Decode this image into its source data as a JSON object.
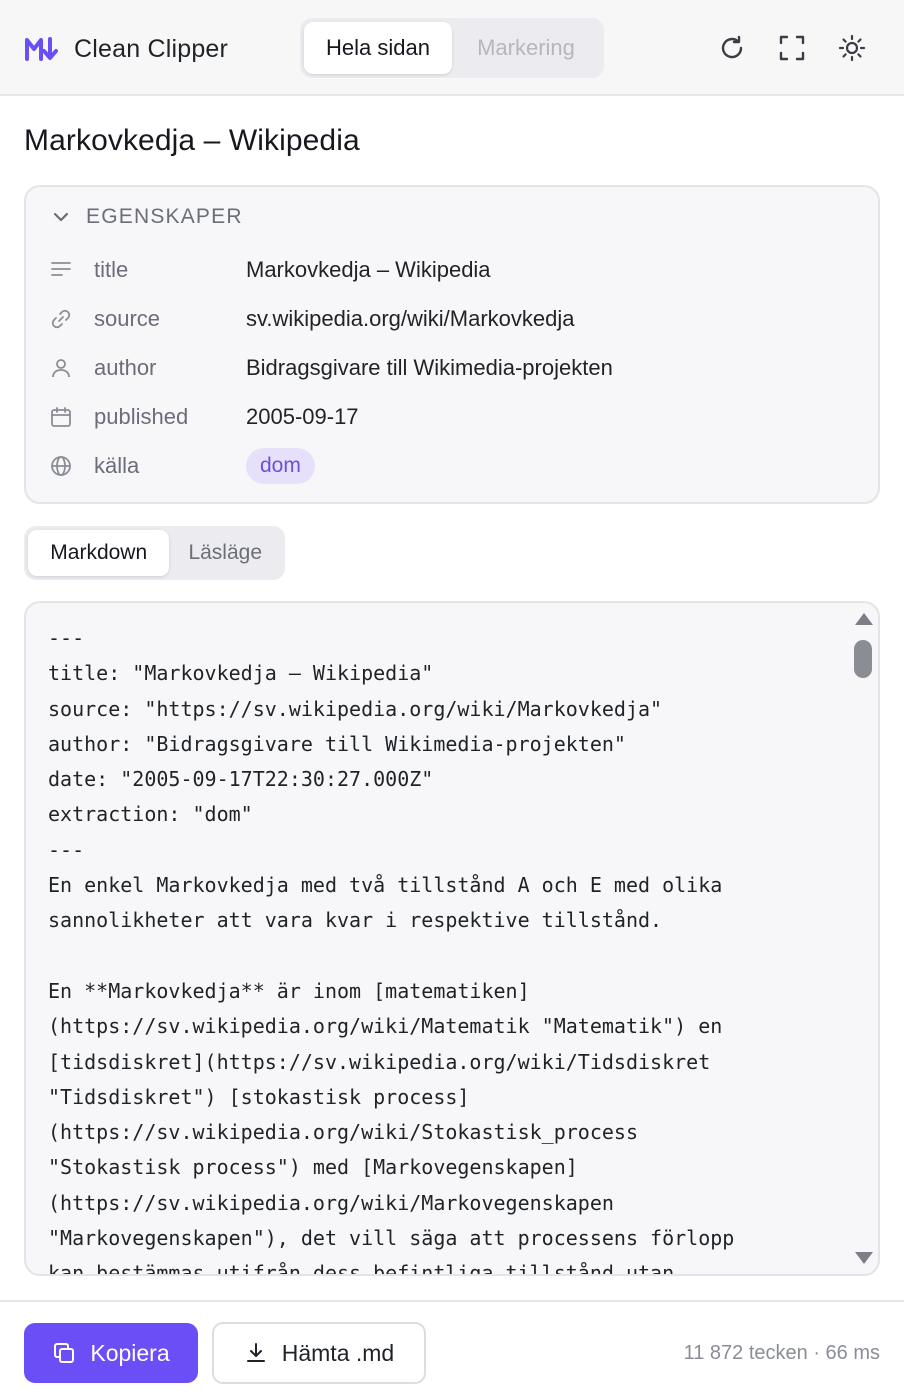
{
  "header": {
    "app_name": "Clean Clipper",
    "modes": [
      "Hela sidan",
      "Markering"
    ],
    "active_mode": "Hela sidan",
    "icons": [
      "refresh-icon",
      "expand-icon",
      "theme-sun-icon"
    ]
  },
  "page": {
    "title": "Markovkedja – Wikipedia"
  },
  "properties": {
    "heading": "EGENSKAPER",
    "rows": [
      {
        "icon": "text-lines-icon",
        "key": "title",
        "value": "Markovkedja – Wikipedia"
      },
      {
        "icon": "link-icon",
        "key": "source",
        "value": "sv.wikipedia.org/wiki/Markovkedja"
      },
      {
        "icon": "user-icon",
        "key": "author",
        "value": "Bidragsgivare till Wikimedia-projekten"
      },
      {
        "icon": "calendar-icon",
        "key": "published",
        "value": "2005-09-17"
      },
      {
        "icon": "globe-icon",
        "key": "källa",
        "value": "dom"
      }
    ]
  },
  "view_tabs": {
    "tabs": [
      "Markdown",
      "Läsläge"
    ],
    "active": "Markdown"
  },
  "markdown": {
    "text": "---\ntitle: \"Markovkedja – Wikipedia\"\nsource: \"https://sv.wikipedia.org/wiki/Markovkedja\"\nauthor: \"Bidragsgivare till Wikimedia-projekten\"\ndate: \"2005-09-17T22:30:27.000Z\"\nextraction: \"dom\"\n---\nEn enkel Markovkedja med två tillstånd A och E med olika\nsannolikheter att vara kvar i respektive tillstånd.\n\nEn **Markovkedja** är inom [matematiken]\n(https://sv.wikipedia.org/wiki/Matematik \"Matematik\") en\n[tidsdiskret](https://sv.wikipedia.org/wiki/Tidsdiskret\n\"Tidsdiskret\") [stokastisk process]\n(https://sv.wikipedia.org/wiki/Stokastisk_process\n\"Stokastisk process\") med [Markovegenskapen]\n(https://sv.wikipedia.org/wiki/Markovegenskapen\n\"Markovegenskapen\"), det vill säga att processens förlopp\nkan bestämmas utifrån dess befintliga tillstånd utan"
  },
  "footer": {
    "copy_label": "Kopiera",
    "download_label": "Hämta .md",
    "stats": "11 872 tecken · 66 ms"
  },
  "colors": {
    "accent": "#6b4ef5",
    "tag_bg": "#e7e0fb",
    "tag_text": "#6a4fe0"
  }
}
